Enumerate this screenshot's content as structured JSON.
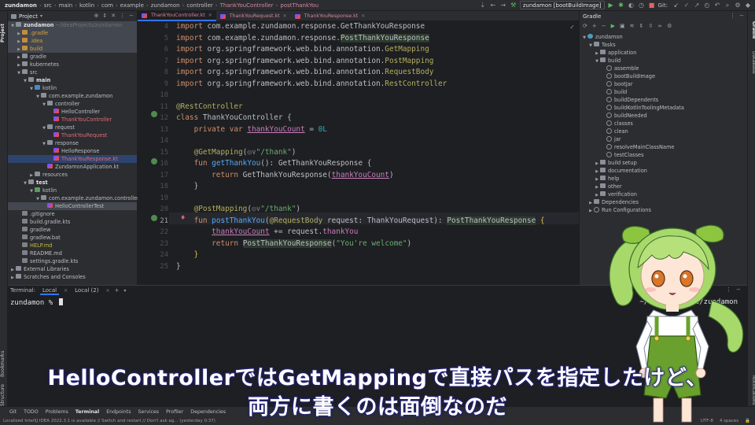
{
  "navbar": {
    "crumbs": [
      "zundamon",
      "src",
      "main",
      "kotlin",
      "com",
      "example",
      "zundamon",
      "controller"
    ],
    "file": "ThankYouController",
    "func": "postThankYou",
    "run_config": "zundamon [bootBuildImage]",
    "git_label": "Git:"
  },
  "project": {
    "title": "Project",
    "items": [
      {
        "label": "zundamon",
        "extra": "~/IdeaProjects/zundamon",
        "depth": 0,
        "open": true,
        "icon": "folder",
        "style": "b",
        "hl": true
      },
      {
        "label": ".gradle",
        "depth": 1,
        "open": false,
        "icon": "folder-y",
        "style": "orange",
        "hl": true
      },
      {
        "label": ".idea",
        "depth": 1,
        "open": false,
        "icon": "folder-y",
        "style": "orange",
        "hl": true
      },
      {
        "label": "build",
        "depth": 1,
        "open": false,
        "icon": "folder-y",
        "style": "orange",
        "hl": true
      },
      {
        "label": "gradle",
        "depth": 1,
        "open": false,
        "icon": "folder",
        "style": "main"
      },
      {
        "label": "kubernetes",
        "depth": 1,
        "open": false,
        "icon": "folder",
        "style": "main"
      },
      {
        "label": "src",
        "depth": 1,
        "open": true,
        "icon": "folder",
        "style": "main"
      },
      {
        "label": "main",
        "depth": 2,
        "open": true,
        "icon": "folder",
        "style": "b"
      },
      {
        "label": "kotlin",
        "depth": 3,
        "open": true,
        "icon": "folder-src",
        "style": "main"
      },
      {
        "label": "com.example.zundamon",
        "depth": 4,
        "open": true,
        "icon": "folder",
        "style": "main"
      },
      {
        "label": "controller",
        "depth": 5,
        "open": true,
        "icon": "folder",
        "style": "main"
      },
      {
        "label": "HelloController",
        "depth": 6,
        "icon": "kt",
        "style": "main"
      },
      {
        "label": "ThankYouController",
        "depth": 6,
        "icon": "kt",
        "style": "red"
      },
      {
        "label": "request",
        "depth": 5,
        "open": true,
        "icon": "folder",
        "style": "main"
      },
      {
        "label": "ThankYouRequest",
        "depth": 6,
        "icon": "kt",
        "style": "red"
      },
      {
        "label": "response",
        "depth": 5,
        "open": true,
        "icon": "folder",
        "style": "main"
      },
      {
        "label": "HelloResponse",
        "depth": 6,
        "icon": "kt",
        "style": "main"
      },
      {
        "label": "ThankYouResponse.kt",
        "depth": 6,
        "icon": "kt",
        "style": "red",
        "sel": true
      },
      {
        "label": "ZundamonApplication.kt",
        "depth": 5,
        "icon": "kt",
        "style": "main"
      },
      {
        "label": "resources",
        "depth": 3,
        "open": false,
        "icon": "folder",
        "style": "main"
      },
      {
        "label": "test",
        "depth": 2,
        "open": true,
        "icon": "folder",
        "style": "b"
      },
      {
        "label": "kotlin",
        "depth": 3,
        "open": true,
        "icon": "folder-tst",
        "style": "main"
      },
      {
        "label": "com.example.zundamon.controller",
        "depth": 4,
        "open": true,
        "icon": "folder",
        "style": "main"
      },
      {
        "label": "HelloControllerTest",
        "depth": 5,
        "icon": "kt",
        "style": "main",
        "hl": true
      },
      {
        "label": ".gitignore",
        "depth": 1,
        "icon": "file",
        "style": "main"
      },
      {
        "label": "build.gradle.kts",
        "depth": 1,
        "icon": "file",
        "style": "main"
      },
      {
        "label": "gradlew",
        "depth": 1,
        "icon": "file",
        "style": "main"
      },
      {
        "label": "gradlew.bat",
        "depth": 1,
        "icon": "file",
        "style": "main"
      },
      {
        "label": "HELP.md",
        "depth": 1,
        "icon": "file",
        "style": "yellow"
      },
      {
        "label": "README.md",
        "depth": 1,
        "icon": "file",
        "style": "main"
      },
      {
        "label": "settings.gradle.kts",
        "depth": 1,
        "icon": "file",
        "style": "main"
      },
      {
        "label": "External Libraries",
        "depth": 0,
        "open": false,
        "icon": "folder",
        "style": "main"
      },
      {
        "label": "Scratches and Consoles",
        "depth": 0,
        "open": false,
        "icon": "folder",
        "style": "main"
      }
    ]
  },
  "tabs": [
    {
      "label": "ThankYouController.kt",
      "active": true
    },
    {
      "label": "ThankYouRequest.kt",
      "active": false
    },
    {
      "label": "ThankYouResponse.kt",
      "active": false
    }
  ],
  "editor": {
    "lines": [
      {
        "n": "4",
        "html": "<span class='kw'>import</span> com.example.zundamon.response.GetThankYouResponse"
      },
      {
        "n": "5",
        "html": "<span class='kw'>import</span> com.example.zundamon.response.<span class='hlbox'>PostThankYouResponse</span>"
      },
      {
        "n": "6",
        "html": "<span class='kw'>import</span> org.springframework.web.bind.annotation.<span class='an'>GetMapping</span>"
      },
      {
        "n": "7",
        "html": "<span class='kw'>import</span> org.springframework.web.bind.annotation.<span class='an'>PostMapping</span>"
      },
      {
        "n": "8",
        "html": "<span class='kw'>import</span> org.springframework.web.bind.annotation.<span class='an'>RequestBody</span>"
      },
      {
        "n": "9",
        "html": "<span class='kw'>import</span> org.springframework.web.bind.annotation.<span class='an'>RestController</span>"
      },
      {
        "n": "10",
        "html": ""
      },
      {
        "n": "11",
        "html": "<span class='an'>@RestController</span>"
      },
      {
        "n": "12",
        "html": "<span class='kw'>class</span> ThankYouController {"
      },
      {
        "n": "13",
        "html": "    <span class='kw'>private var</span> <span class='pr' style='text-decoration:underline'>thankYouCount</span> = <span class='nm'>0L</span>"
      },
      {
        "n": "14",
        "html": ""
      },
      {
        "n": "15",
        "html": "    <span class='an'>@GetMapping</span>(<span class='gy'>◎∨</span><span class='st'>\"/thank\"</span>)"
      },
      {
        "n": "16",
        "html": "    <span class='kw'>fun</span> <span class='fn'>getThankYou</span>(): GetThankYouResponse {"
      },
      {
        "n": "17",
        "html": "        <span class='kw'>return</span> GetThankYouResponse(<span class='pr' style='text-decoration:underline'>thankYouCount</span>)"
      },
      {
        "n": "18",
        "html": "    }"
      },
      {
        "n": "19",
        "html": ""
      },
      {
        "n": "20",
        "html": "    <span class='an'>@PostMapping</span>(<span class='gy'>◎∨</span><span class='st'>\"/thank\"</span>)"
      },
      {
        "n": "21",
        "html": "    <span class='kw'>fun</span> <span class='fn'>postThankYou</span>(<span class='an'>@RequestBody</span> request: ThankYouRequest): <span class='hlbox'>PostThankYouResponse</span> <span style='color:#e0c050'>{</span>"
      },
      {
        "n": "22",
        "html": "        <span class='pr' style='text-decoration:underline'>thankYouCount</span> += request.<span class='pr'>thankYou</span>"
      },
      {
        "n": "23",
        "html": "        <span class='kw'>return</span> <span class='hlbox'>PostThankYouResponse</span>(<span class='st'>\"You're welcome\"</span>)"
      },
      {
        "n": "24",
        "html": "    <span style='color:#e0c050'>}</span>"
      },
      {
        "n": "25",
        "html": "}"
      }
    ]
  },
  "gradle": {
    "title": "Gradle",
    "items": [
      {
        "label": "zundamon",
        "depth": 0,
        "open": true,
        "icon": "elephant"
      },
      {
        "label": "Tasks",
        "depth": 1,
        "open": true,
        "icon": "folder"
      },
      {
        "label": "application",
        "depth": 2,
        "open": false,
        "icon": "folder"
      },
      {
        "label": "build",
        "depth": 2,
        "open": true,
        "icon": "folder"
      },
      {
        "label": "assemble",
        "depth": 3,
        "icon": "gear"
      },
      {
        "label": "bootBuildImage",
        "depth": 3,
        "icon": "gear"
      },
      {
        "label": "bootJar",
        "depth": 3,
        "icon": "gear"
      },
      {
        "label": "build",
        "depth": 3,
        "icon": "gear"
      },
      {
        "label": "buildDependents",
        "depth": 3,
        "icon": "gear"
      },
      {
        "label": "buildKotlinToolingMetadata",
        "depth": 3,
        "icon": "gear"
      },
      {
        "label": "buildNeeded",
        "depth": 3,
        "icon": "gear"
      },
      {
        "label": "classes",
        "depth": 3,
        "icon": "gear"
      },
      {
        "label": "clean",
        "depth": 3,
        "icon": "gear"
      },
      {
        "label": "jar",
        "depth": 3,
        "icon": "gear"
      },
      {
        "label": "resolveMainClassName",
        "depth": 3,
        "icon": "gear"
      },
      {
        "label": "testClasses",
        "depth": 3,
        "icon": "gear"
      },
      {
        "label": "build setup",
        "depth": 2,
        "open": false,
        "icon": "folder"
      },
      {
        "label": "documentation",
        "depth": 2,
        "open": false,
        "icon": "folder"
      },
      {
        "label": "help",
        "depth": 2,
        "open": false,
        "icon": "folder"
      },
      {
        "label": "other",
        "depth": 2,
        "open": false,
        "icon": "folder"
      },
      {
        "label": "verification",
        "depth": 2,
        "open": false,
        "icon": "folder"
      },
      {
        "label": "Dependencies",
        "depth": 1,
        "open": false,
        "icon": "folder"
      },
      {
        "label": "Run Configurations",
        "depth": 1,
        "open": false,
        "icon": "gear"
      }
    ]
  },
  "terminal": {
    "label": "Terminal:",
    "tabs": [
      "Local",
      "Local (2)"
    ],
    "prompt": "zundamon % ",
    "path": "~/IdeaProjects/zundamon"
  },
  "bottom_tools": [
    "Git",
    "TODO",
    "Problems",
    "Terminal",
    "Endpoints",
    "Services",
    "Profiler",
    "Dependencies"
  ],
  "status": {
    "message": "Localized IntelliJ IDEA 2022.3.1 is available // Switch and restart // Don't ask ag... (yesterday 0:37)",
    "encoding": "UTF-8",
    "indent": "4 spaces"
  },
  "left_labels": [
    "Project",
    "Bookmarks",
    "Structure"
  ],
  "right_labels": [
    "Gradle",
    "Database",
    "Notifications"
  ],
  "subtitle": {
    "line1": "HelloControllerではGetMappingで直接パスを指定したけど、",
    "line2": "両方に書くのは面倒なのだ"
  }
}
